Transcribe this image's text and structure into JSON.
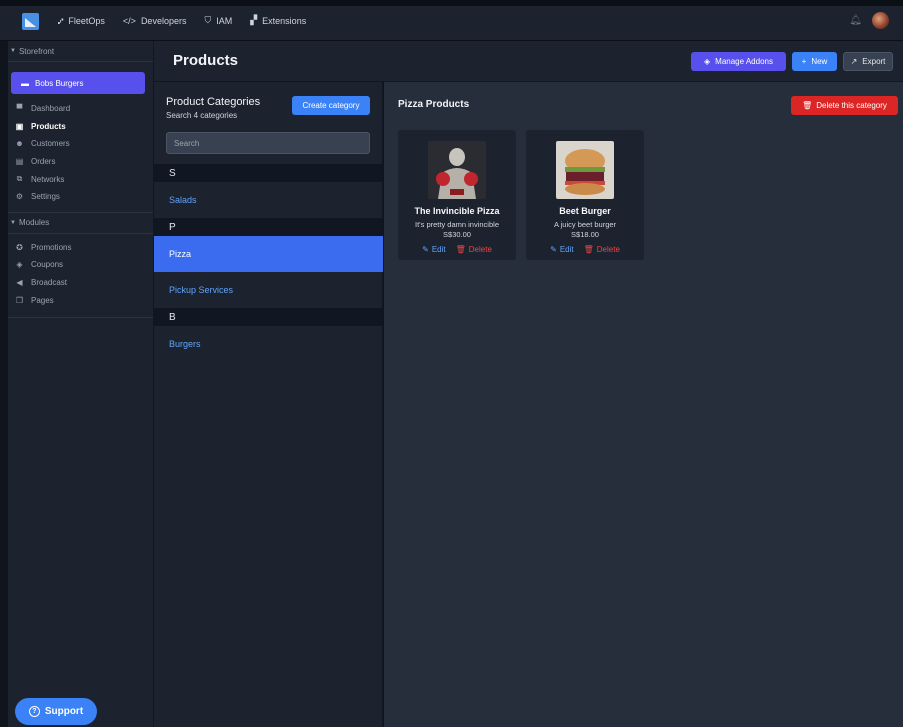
{
  "topbar": {
    "nav": [
      {
        "label": "FleetOps",
        "icon": "route-icon"
      },
      {
        "label": "Developers",
        "icon": "code-icon"
      },
      {
        "label": "IAM",
        "icon": "shield-icon"
      },
      {
        "label": "Extensions",
        "icon": "puzzle-icon"
      }
    ]
  },
  "sidebar": {
    "storefront_label": "Storefront",
    "store_name": "Bobs Burgers",
    "items": [
      {
        "label": "Dashboard",
        "icon": "dashboard-icon"
      },
      {
        "label": "Products",
        "icon": "box-icon"
      },
      {
        "label": "Customers",
        "icon": "users-icon"
      },
      {
        "label": "Orders",
        "icon": "file-icon"
      },
      {
        "label": "Networks",
        "icon": "network-icon"
      },
      {
        "label": "Settings",
        "icon": "gear-icon"
      }
    ],
    "modules_label": "Modules",
    "modules": [
      {
        "label": "Promotions",
        "icon": "award-icon"
      },
      {
        "label": "Coupons",
        "icon": "tag-icon"
      },
      {
        "label": "Broadcast",
        "icon": "megaphone-icon"
      },
      {
        "label": "Pages",
        "icon": "pages-icon"
      }
    ],
    "support_label": "Support"
  },
  "header": {
    "title": "Products",
    "manage_addons": "Manage Addons",
    "new": "New",
    "export": "Export"
  },
  "categories": {
    "title": "Product Categories",
    "subtitle": "Search 4 categories",
    "create_label": "Create category",
    "search_placeholder": "Search",
    "groups": [
      {
        "letter": "S",
        "items": [
          "Salads"
        ]
      },
      {
        "letter": "P",
        "items": [
          "Pizza",
          "Pickup Services"
        ]
      },
      {
        "letter": "B",
        "items": [
          "Burgers"
        ]
      }
    ],
    "active": "Pizza"
  },
  "products": {
    "title": "Pizza Products",
    "delete_category": "Delete this category",
    "edit_label": "Edit",
    "delete_label": "Delete",
    "items": [
      {
        "name": "The Invincible Pizza",
        "description": "It's pretty damn invincible",
        "price": "S$30.00"
      },
      {
        "name": "Beet Burger",
        "description": "A juicy beet burger",
        "price": "S$18.00"
      }
    ]
  },
  "colors": {
    "accent": "#5850ec",
    "primary": "#3b82f6",
    "danger": "#dc2626"
  }
}
